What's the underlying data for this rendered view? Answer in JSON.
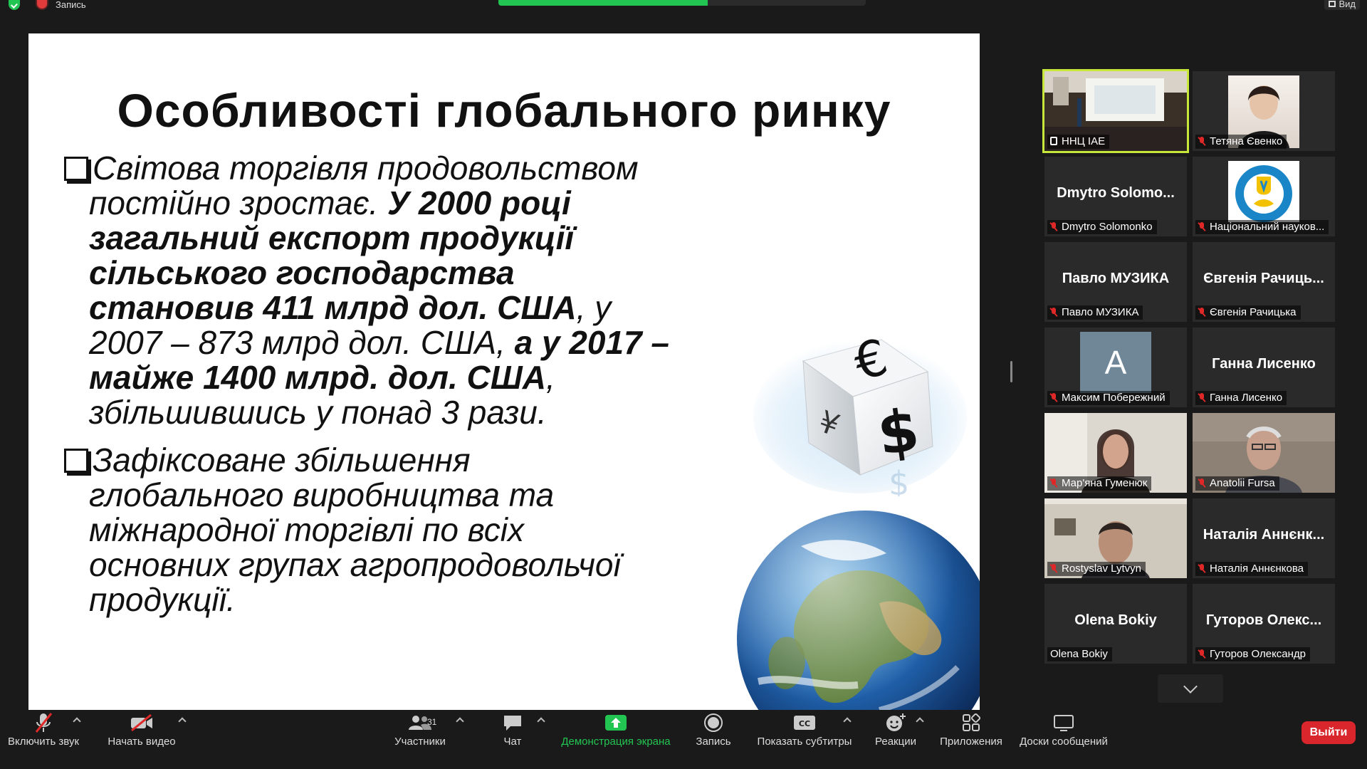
{
  "topbar": {
    "recording_label": "Запись",
    "view_label": "Вид"
  },
  "slide": {
    "title": "Особливості глобального ринку",
    "bullet1": {
      "lines": [
        {
          "parts": [
            {
              "t": "Світова торгівля продовольством",
              "b": false
            }
          ]
        },
        {
          "parts": [
            {
              "t": "постійно зростає. ",
              "b": false
            },
            {
              "t": "У 2000 році",
              "b": true
            }
          ]
        },
        {
          "parts": [
            {
              "t": "загальний експорт продукції",
              "b": true
            }
          ]
        },
        {
          "parts": [
            {
              "t": "сільського господарства",
              "b": true
            }
          ]
        },
        {
          "parts": [
            {
              "t": "становив 411 млрд дол. США",
              "b": true
            },
            {
              "t": ", у",
              "b": false
            }
          ]
        },
        {
          "parts": [
            {
              "t": "2007 – 873 млрд дол. США, ",
              "b": false
            },
            {
              "t": "а у 2017 –",
              "b": true
            }
          ]
        },
        {
          "parts": [
            {
              "t": "майже 1400 млрд. дол. США",
              "b": true
            },
            {
              "t": ",",
              "b": false
            }
          ]
        },
        {
          "parts": [
            {
              "t": "збільшившись у понад 3 рази.",
              "b": false
            }
          ]
        }
      ]
    },
    "bullet2": {
      "lines": [
        {
          "parts": [
            {
              "t": "Зафіксоване збільшення",
              "b": false
            }
          ]
        },
        {
          "parts": [
            {
              "t": "глобального виробництва та",
              "b": false
            }
          ]
        },
        {
          "parts": [
            {
              "t": "міжнародної торгівлі по всіх",
              "b": false
            }
          ]
        },
        {
          "parts": [
            {
              "t": "основних групах агропродовольчої",
              "b": false
            }
          ]
        },
        {
          "parts": [
            {
              "t": "продукції.",
              "b": false
            }
          ]
        }
      ]
    }
  },
  "participants": [
    {
      "label": "ННЦ ІАЕ",
      "big": "",
      "muted": false,
      "pinned": true,
      "kind": "video-hall",
      "active": true
    },
    {
      "label": "Тетяна Євенко",
      "big": "",
      "muted": true,
      "kind": "photo-tatyana"
    },
    {
      "label": "Dmytro Solomonko",
      "big": "Dmytro Solomo...",
      "muted": true,
      "kind": "name"
    },
    {
      "label": "Національний науков...",
      "big": "",
      "muted": true,
      "kind": "logo"
    },
    {
      "label": "Павло МУЗИКА",
      "big": "Павло МУЗИКА",
      "muted": true,
      "kind": "name"
    },
    {
      "label": "Євгенія Рачицька",
      "big": "Євгенія Рачиць...",
      "muted": true,
      "kind": "name"
    },
    {
      "label": "Максим Побережний",
      "big": "",
      "muted": true,
      "kind": "avatar",
      "avatar_letter": "A"
    },
    {
      "label": "Ганна Лисенко",
      "big": "Ганна Лисенко",
      "muted": true,
      "kind": "name"
    },
    {
      "label": "Мар'яна Гуменюк",
      "big": "",
      "muted": true,
      "kind": "video-woman"
    },
    {
      "label": "Anatolii Fursa",
      "big": "",
      "muted": true,
      "kind": "video-man1"
    },
    {
      "label": "Rostyslav Lytvyn",
      "big": "",
      "muted": true,
      "kind": "video-man2"
    },
    {
      "label": "Наталія Аннєнкова",
      "big": "Наталія Аннєнк...",
      "muted": true,
      "kind": "name"
    },
    {
      "label": "Olena Bokiy",
      "big": "Olena Bokiy",
      "muted": false,
      "kind": "name"
    },
    {
      "label": "Гуторов Олександр",
      "big": "Гуторов Олекс...",
      "muted": true,
      "kind": "name"
    }
  ],
  "toolbar": {
    "unmute": "Включить звук",
    "start_video": "Начать видео",
    "participants": "Участники",
    "participants_count": "31",
    "chat": "Чат",
    "share_screen": "Демонстрация экрана",
    "record": "Запись",
    "captions": "Показать субтитры",
    "reactions": "Реакции",
    "apps": "Приложения",
    "whiteboards": "Доски сообщений",
    "leave": "Выйти"
  },
  "colors": {
    "accent_green": "#23c552",
    "leave_red": "#d8262c",
    "active_speaker": "#c7e83b",
    "muted_red": "#e02828"
  },
  "icons": [
    "shield-icon",
    "record-icon",
    "view-icon",
    "mic-off-icon",
    "video-off-icon",
    "participants-icon",
    "chat-icon",
    "share-screen-icon",
    "record-button-icon",
    "cc-icon",
    "reactions-icon",
    "apps-icon",
    "whiteboard-icon",
    "chevron-down-icon"
  ]
}
